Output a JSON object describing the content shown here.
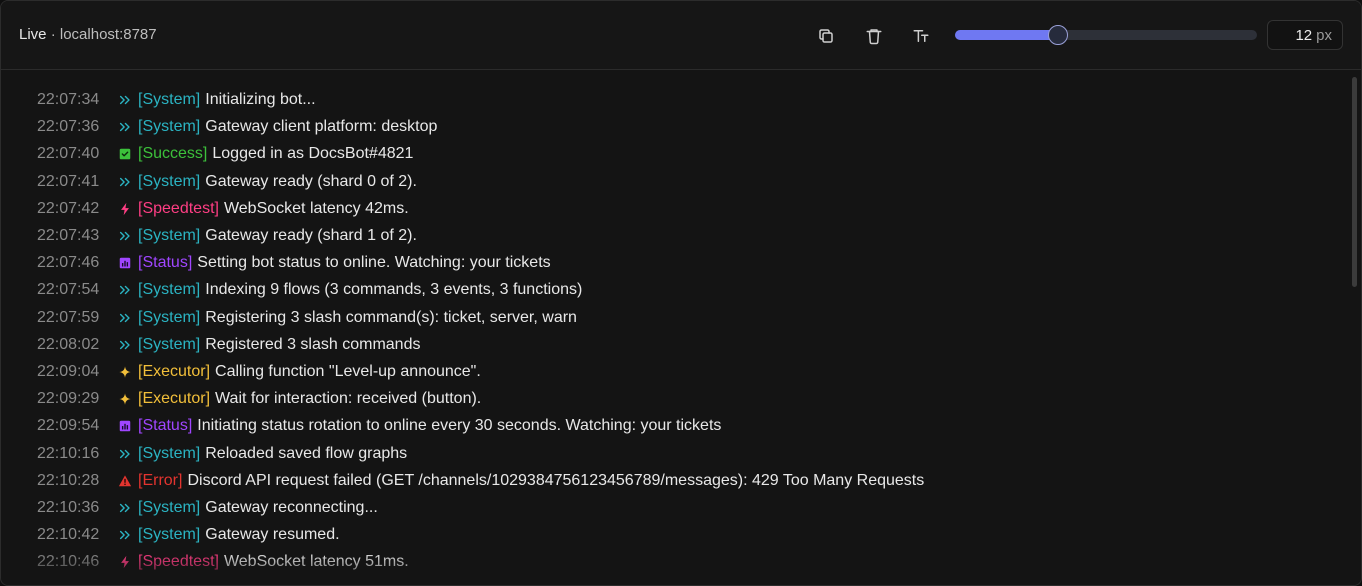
{
  "header": {
    "live_label": "Live",
    "separator": " · ",
    "host": "localhost:8787",
    "font_size": {
      "value": "12",
      "unit": "px"
    },
    "slider_fraction": 0.34,
    "actions": [
      {
        "name": "copy-button",
        "icon": "copy-icon"
      },
      {
        "name": "clear-button",
        "icon": "trash-icon"
      },
      {
        "name": "font-size-button",
        "icon": "text-size-icon"
      }
    ]
  },
  "colors": {
    "System": "#2bb3c2",
    "Success": "#3cc13b",
    "Speedtest": "#ff3e84",
    "Status": "#a046ff",
    "Executor": "#f2bf3a",
    "Error": "#e3342f"
  },
  "logs": [
    {
      "time": "22:07:34",
      "tag": "System",
      "icon": "chevron-double-right-icon",
      "message": "Initializing bot..."
    },
    {
      "time": "22:07:36",
      "tag": "System",
      "icon": "chevron-double-right-icon",
      "message": "Gateway client platform: desktop"
    },
    {
      "time": "22:07:40",
      "tag": "Success",
      "icon": "check-square-icon",
      "message": "Logged in as DocsBot#4821"
    },
    {
      "time": "22:07:41",
      "tag": "System",
      "icon": "chevron-double-right-icon",
      "message": "Gateway ready (shard 0 of 2)."
    },
    {
      "time": "22:07:42",
      "tag": "Speedtest",
      "icon": "lightning-icon",
      "message": "WebSocket latency 42ms."
    },
    {
      "time": "22:07:43",
      "tag": "System",
      "icon": "chevron-double-right-icon",
      "message": "Gateway ready (shard 1 of 2)."
    },
    {
      "time": "22:07:46",
      "tag": "Status",
      "icon": "bar-chart-icon",
      "message": "Setting bot status to online. Watching: your tickets"
    },
    {
      "time": "22:07:54",
      "tag": "System",
      "icon": "chevron-double-right-icon",
      "message": "Indexing 9 flows (3 commands, 3 events, 3 functions)"
    },
    {
      "time": "22:07:59",
      "tag": "System",
      "icon": "chevron-double-right-icon",
      "message": "Registering 3 slash command(s): ticket, server, warn"
    },
    {
      "time": "22:08:02",
      "tag": "System",
      "icon": "chevron-double-right-icon",
      "message": "Registered 3 slash commands"
    },
    {
      "time": "22:09:04",
      "tag": "Executor",
      "icon": "sparkle-icon",
      "message": "Calling function \"Level-up announce\"."
    },
    {
      "time": "22:09:29",
      "tag": "Executor",
      "icon": "sparkle-icon",
      "message": "Wait for interaction: received (button)."
    },
    {
      "time": "22:09:54",
      "tag": "Status",
      "icon": "bar-chart-icon",
      "message": "Initiating status rotation to online every 30 seconds. Watching: your tickets"
    },
    {
      "time": "22:10:16",
      "tag": "System",
      "icon": "chevron-double-right-icon",
      "message": "Reloaded saved flow graphs"
    },
    {
      "time": "22:10:28",
      "tag": "Error",
      "icon": "warning-triangle-icon",
      "message": "Discord API request failed (GET /channels/1029384756123456789/messages): 429 Too Many Requests"
    },
    {
      "time": "22:10:36",
      "tag": "System",
      "icon": "chevron-double-right-icon",
      "message": "Gateway reconnecting..."
    },
    {
      "time": "22:10:42",
      "tag": "System",
      "icon": "chevron-double-right-icon",
      "message": "Gateway resumed."
    },
    {
      "time": "22:10:46",
      "tag": "Speedtest",
      "icon": "lightning-icon",
      "message": "WebSocket latency 51ms."
    }
  ]
}
